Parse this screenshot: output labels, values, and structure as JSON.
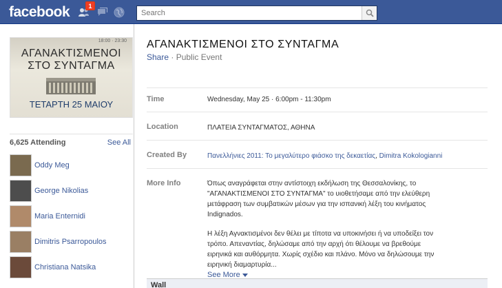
{
  "topbar": {
    "logo": "facebook",
    "notification_count": "1",
    "search_placeholder": "Search"
  },
  "left": {
    "poster": {
      "time_text": "18:00 · 23:30",
      "line1": "ΑΓΑΝΑΚΤΙΣΜΕΝΟΙ",
      "line2": "ΣΤΟ ΣΥΝΤΑΓΜΑ",
      "date_line": "ΤΕΤΑΡΤΗ 25 ΜΑΙΟΥ"
    },
    "attending_label": "6,625 Attending",
    "see_all": "See All",
    "people": [
      {
        "name": "Oddy Meg",
        "color": "#7a6a4f"
      },
      {
        "name": "George Nikolias",
        "color": "#4d4d4d"
      },
      {
        "name": "Maria Enternidi",
        "color": "#b08a6a"
      },
      {
        "name": "Dimitris Psarropoulos",
        "color": "#9a7f64"
      },
      {
        "name": "Christiana Natsika",
        "color": "#6b4a3a"
      }
    ]
  },
  "main": {
    "title": "ΑΓΑΝΑΚΤΙΣΜΕΝΟΙ ΣΤΟ ΣΥΝΤΑΓΜΑ",
    "share": "Share",
    "separator": " · ",
    "event_type": "Public Event",
    "time_label": "Time",
    "time_value": "Wednesday, May 25 · 6:00pm - 11:30pm",
    "location_label": "Location",
    "location_value": "ΠΛΑΤΕΙΑ ΣΥΝΤΑΓΜΑΤΟΣ, ΑΘΗΝΑ",
    "created_label": "Created By",
    "creator1": "Πανελλήνιες 2011: Το μεγαλύτερο φιάσκο της δεκαετίας",
    "creator_sep": ", ",
    "creator2": "Dimitra Kokologianni",
    "more_label": "More Info",
    "para1": "Όπως αναγράφεται στην αντίστοιχη εκδήλωση της Θεσσαλονίκης, το \"ΑΓΑΝΑΚΤΙΣΜΕΝΟΙ ΣΤΟ ΣΥΝΤΑΓΜΑ\" το υιοθετήσαμε από την ελεύθερη μετάφραση των συμβατικών μέσων για την ισπανική λέξη του κινήματος Indignados.",
    "para2": "Η λέξη Αγνακτισμένοι δεν θέλει με τίποτα να υποκινήσει ή να υποδείξει τον τρόπο. Απεναντίας, δηλώσαμε από την αρχή ότι θέλουμε να βρεθούμε ειρηνικά και αυθόρμητα. Χωρίς σχέδιο και πλάνο. Μόνο να δηλώσουμε την ειρηνική διαμαρτυρία...",
    "see_more": "See More",
    "wall": "Wall"
  },
  "colors": {
    "brand_blue": "#3b5998",
    "badge_red": "#f03d25"
  }
}
